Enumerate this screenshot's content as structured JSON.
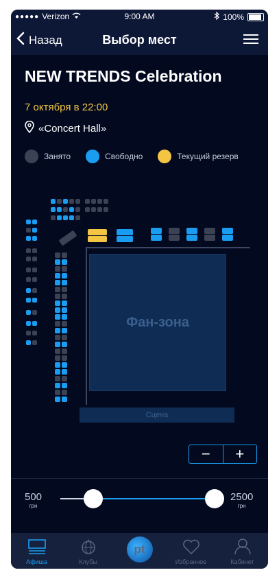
{
  "status_bar": {
    "signal_dots": "●●●●●",
    "carrier": "Verizon",
    "time": "9:00 AM",
    "battery": "100%"
  },
  "nav": {
    "back_label": "Назад",
    "title": "Выбор мест"
  },
  "event": {
    "title": "NEW TRENDS Celebration",
    "date": "7 октября в 22:00",
    "venue": "«Concert Hall»"
  },
  "legend": [
    {
      "label": "Занято",
      "color": "#3a4254"
    },
    {
      "label": "Свободно",
      "color": "#1a9df0"
    },
    {
      "label": "Текущий резерв",
      "color": "#f3c543"
    }
  ],
  "map": {
    "fanzone_label": "Фан-зона",
    "stage_label": "Сцена",
    "zoom_out": "−",
    "zoom_in": "+"
  },
  "price": {
    "min": "500",
    "max": "2500",
    "currency": "грн",
    "range_start_fraction": 0.21,
    "range_end_fraction": 0.98
  },
  "tabs": [
    {
      "label": "Афиша",
      "icon": "poster-icon",
      "active": true
    },
    {
      "label": "Клубы",
      "icon": "disco-ball-icon",
      "active": false
    },
    {
      "label": "pt",
      "icon": "pt-logo",
      "active": false
    },
    {
      "label": "Избранное",
      "icon": "heart-icon",
      "active": false
    },
    {
      "label": "Кабинет",
      "icon": "profile-icon",
      "active": false
    }
  ]
}
